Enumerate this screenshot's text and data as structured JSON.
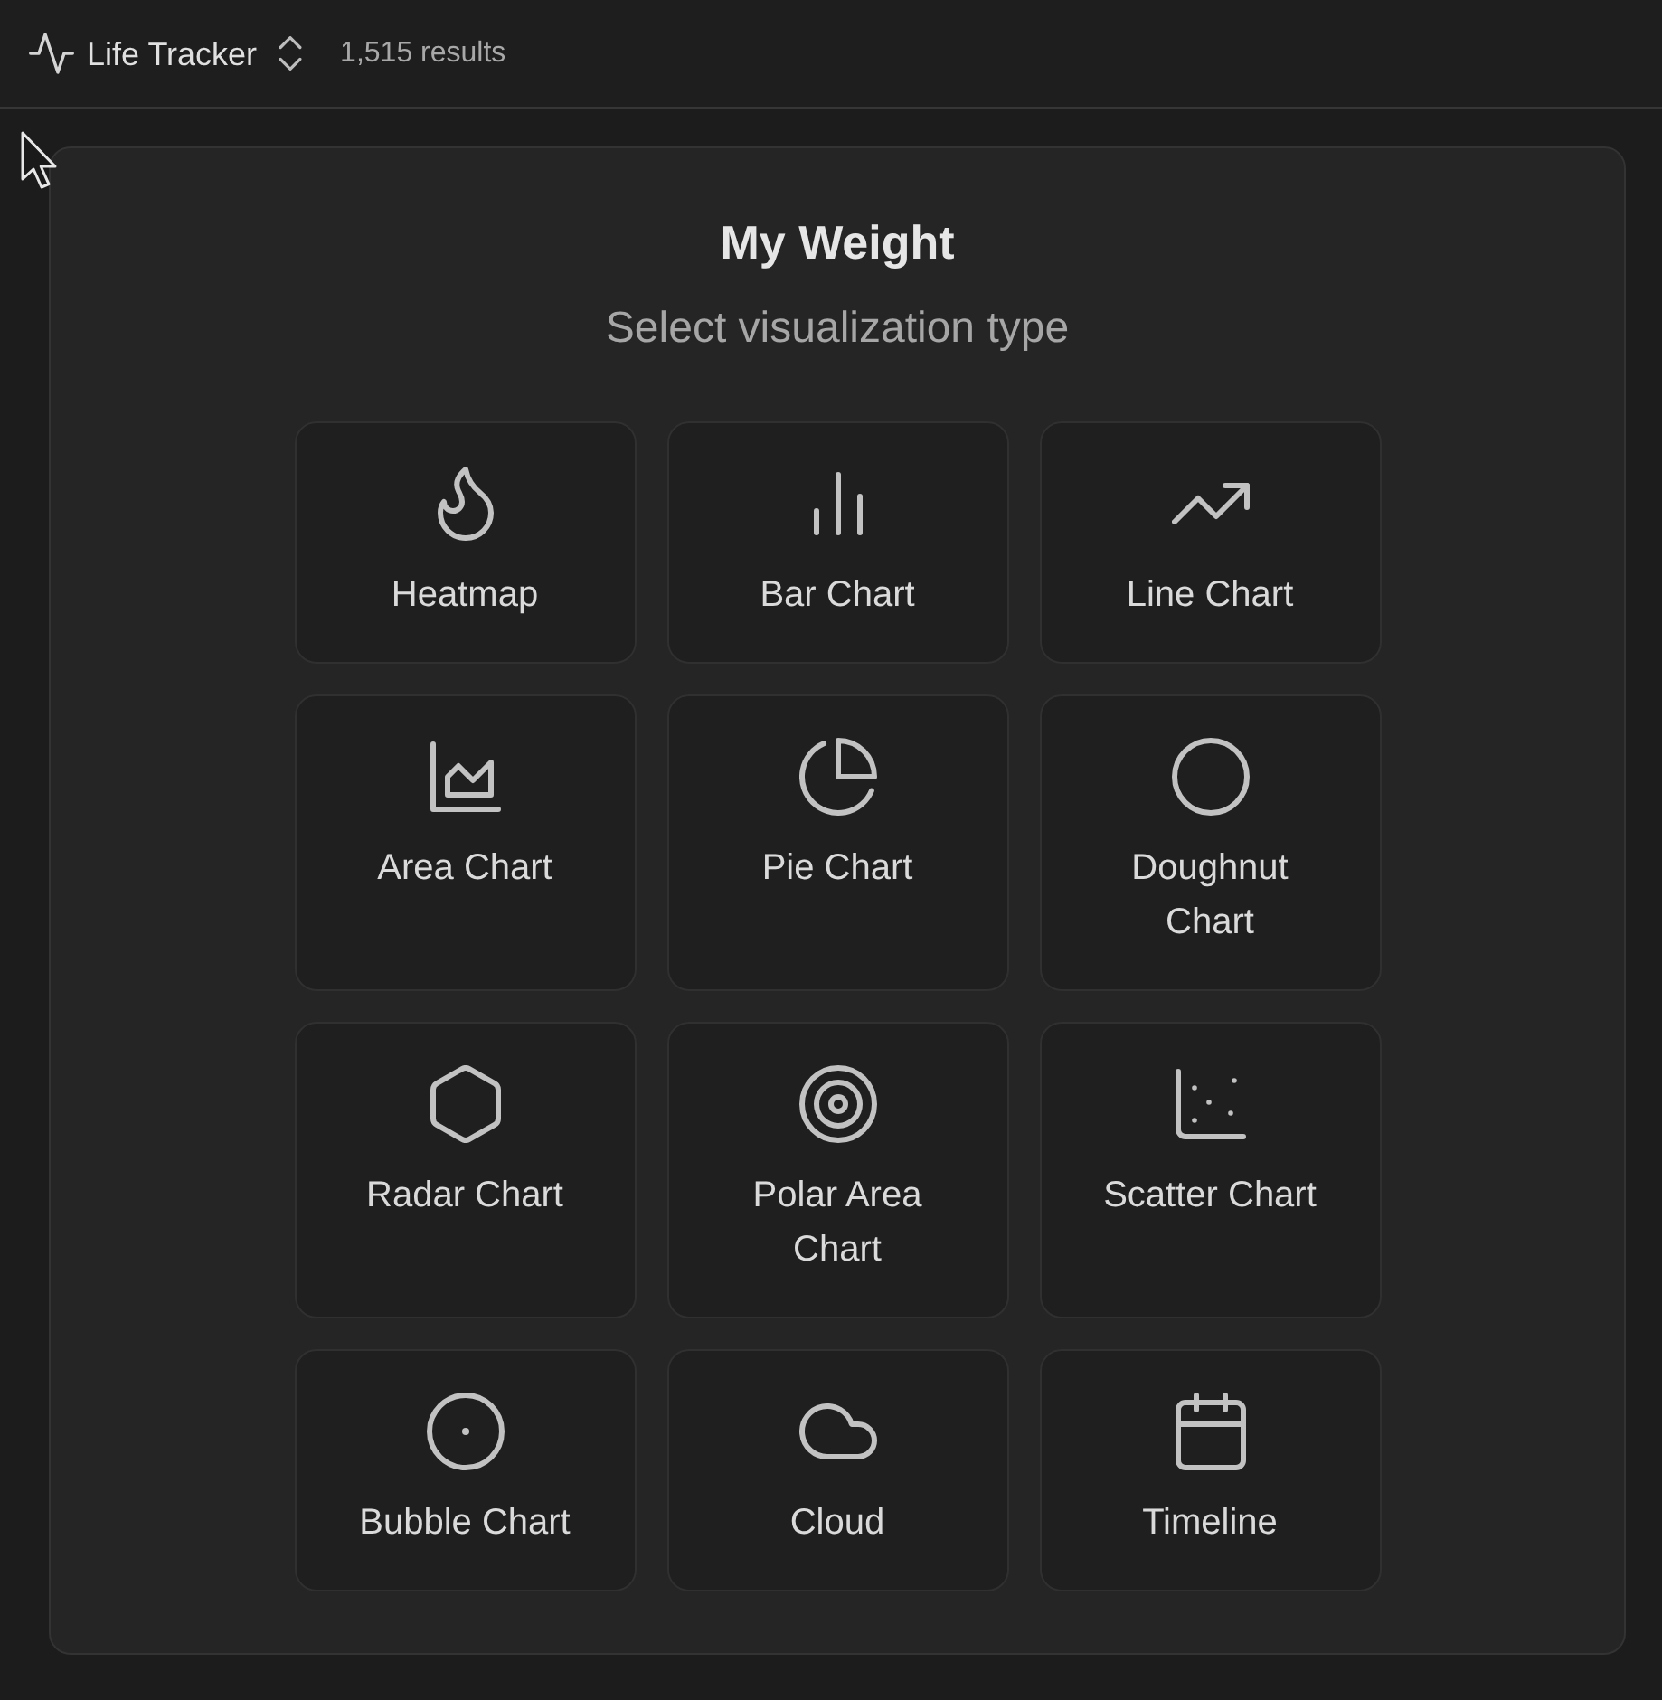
{
  "header": {
    "app_name": "Life Tracker",
    "result_count": "1,515 results"
  },
  "dialog": {
    "title": "My Weight",
    "subtitle": "Select visualization type",
    "options": [
      {
        "kind": "heatmap",
        "label": "Heatmap"
      },
      {
        "kind": "bar",
        "label": "Bar Chart"
      },
      {
        "kind": "line",
        "label": "Line Chart"
      },
      {
        "kind": "area",
        "label": "Area Chart"
      },
      {
        "kind": "pie",
        "label": "Pie Chart"
      },
      {
        "kind": "doughnut",
        "label": "Doughnut Chart"
      },
      {
        "kind": "radar",
        "label": "Radar Chart"
      },
      {
        "kind": "polar",
        "label": "Polar Area Chart"
      },
      {
        "kind": "scatter",
        "label": "Scatter Chart"
      },
      {
        "kind": "bubble",
        "label": "Bubble Chart"
      },
      {
        "kind": "cloud",
        "label": "Cloud"
      },
      {
        "kind": "timeline",
        "label": "Timeline"
      }
    ]
  }
}
